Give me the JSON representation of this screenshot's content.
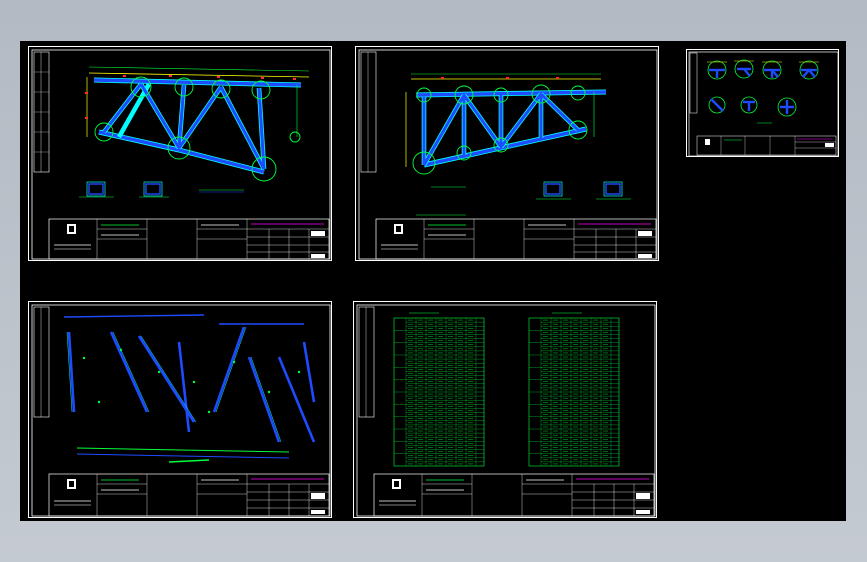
{
  "colors": {
    "background_top": "#b3bac3",
    "viewport": "#000000",
    "frame": "#ffffff",
    "member": "#1f4bff",
    "member_outline": "#00ffff",
    "annotation": "#00ff3c",
    "highlight": "#ffff00",
    "marker": "#ff2a2a",
    "accent": "#ff00ff"
  },
  "sheets": [
    {
      "id": "sheet-1",
      "kind": "truss-elevation"
    },
    {
      "id": "sheet-2",
      "kind": "truss-elevation"
    },
    {
      "id": "sheet-3",
      "kind": "node-details"
    },
    {
      "id": "sheet-4",
      "kind": "member-details"
    },
    {
      "id": "sheet-5",
      "kind": "material-tables"
    }
  ]
}
